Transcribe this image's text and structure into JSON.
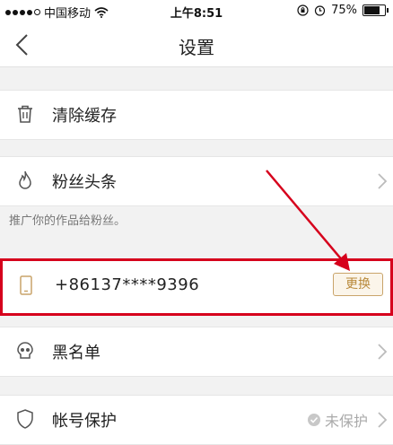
{
  "status_bar": {
    "carrier": "中国移动",
    "time": "上午8:51",
    "battery_percent": "75%",
    "battery_level": 0.75,
    "icons": [
      "signal-dots-icon",
      "wifi-icon",
      "orientation-lock-icon",
      "alarm-icon",
      "battery-icon"
    ]
  },
  "nav": {
    "title": "设置",
    "back_icon": "chevron-left-icon"
  },
  "rows": {
    "clear_cache": {
      "label": "清除缓存",
      "icon": "trash-icon"
    },
    "fans_headline": {
      "label": "粉丝头条",
      "icon": "flame-icon",
      "hint": "推广你的作品给粉丝。"
    },
    "phone": {
      "number": "+86137****9396",
      "icon": "phone-icon",
      "button_label": "更换"
    },
    "blacklist": {
      "label": "黑名单",
      "icon": "skull-icon"
    },
    "account_protection": {
      "label": "帐号保护",
      "icon": "shield-icon",
      "status": "未保护"
    }
  },
  "colors": {
    "highlight_border": "#d6001c",
    "button_gold": "#b98a3c",
    "background": "#f2f2f2"
  }
}
